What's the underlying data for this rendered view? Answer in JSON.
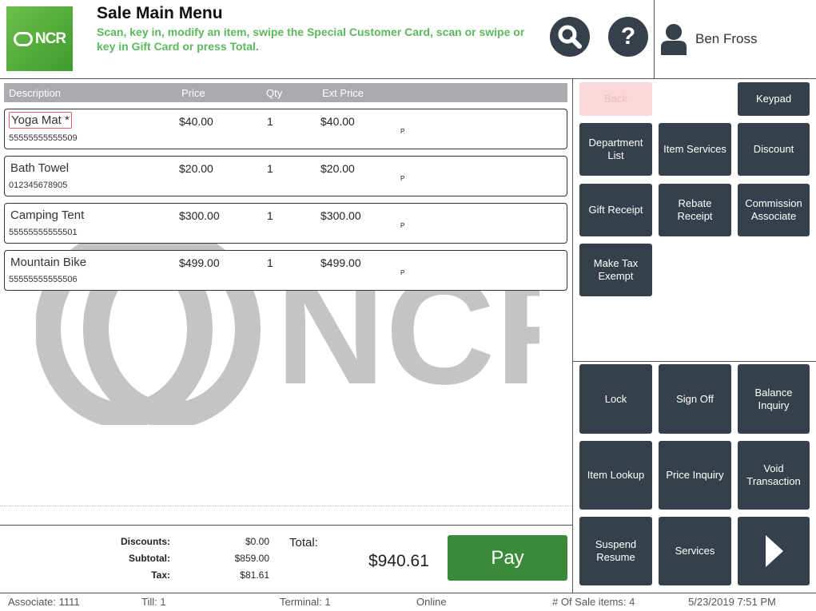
{
  "header": {
    "logo_text": "NCR",
    "title": "Sale Main Menu",
    "subtitle": "Scan, key in, modify an item, swipe the Special Customer Card, scan or swipe or key in Gift Card or press Total.",
    "help_glyph": "?",
    "user_name": "Ben Fross"
  },
  "table": {
    "columns": [
      "Description",
      "Price",
      "Qty",
      "Ext Price"
    ],
    "rows": [
      {
        "description": "Yoga Mat *",
        "sku": "55555555555509",
        "price": "$40.00",
        "qty": "1",
        "ext_price": "$40.00",
        "flag": "P"
      },
      {
        "description": "Bath Towel",
        "sku": "012345678905",
        "price": "$20.00",
        "qty": "1",
        "ext_price": "$20.00",
        "flag": "P"
      },
      {
        "description": "Camping Tent",
        "sku": "55555555555501",
        "price": "$300.00",
        "qty": "1",
        "ext_price": "$300.00",
        "flag": "P"
      },
      {
        "description": "Mountain Bike",
        "sku": "55555555555506",
        "price": "$499.00",
        "qty": "1",
        "ext_price": "$499.00",
        "flag": "P"
      }
    ]
  },
  "totals": {
    "discounts_label": "Discounts:",
    "discounts": "$0.00",
    "subtotal_label": "Subtotal:",
    "subtotal": "$859.00",
    "tax_label": "Tax:",
    "tax": "$81.61",
    "total_label": "Total:",
    "total": "$940.61",
    "pay_label": "Pay"
  },
  "buttons": {
    "back": "Back",
    "keypad": "Keypad",
    "department_list": "Department List",
    "item_services": "Item Services",
    "discount": "Discount",
    "gift_receipt": "Gift Receipt",
    "rebate_receipt": "Rebate Receipt",
    "commission_associate": "Commission Associate",
    "make_tax_exempt": "Make Tax Exempt",
    "lock": "Lock",
    "sign_off": "Sign Off",
    "balance_inquiry": "Balance Inquiry",
    "item_lookup": "Item Lookup",
    "price_inquiry": "Price Inquiry",
    "void_transaction": "Void Transaction",
    "suspend_resume": "Suspend Resume",
    "services": "Services"
  },
  "status_bar": {
    "associate": "Associate: 1111",
    "till": "Till: 1",
    "terminal": "Terminal: 1",
    "connection": "Online",
    "sale_items": "# Of Sale items: 4",
    "datetime": "5/23/2019 7:51 PM"
  },
  "watermark_text": "NCR",
  "colors": {
    "accent_green": "#5cb85c",
    "pay_green": "#3a8a3a",
    "button_dark": "#36404c",
    "header_gray": "#a9abae"
  },
  "icons": [
    "search-icon",
    "help-icon",
    "user-icon",
    "arrow-right-icon"
  ]
}
